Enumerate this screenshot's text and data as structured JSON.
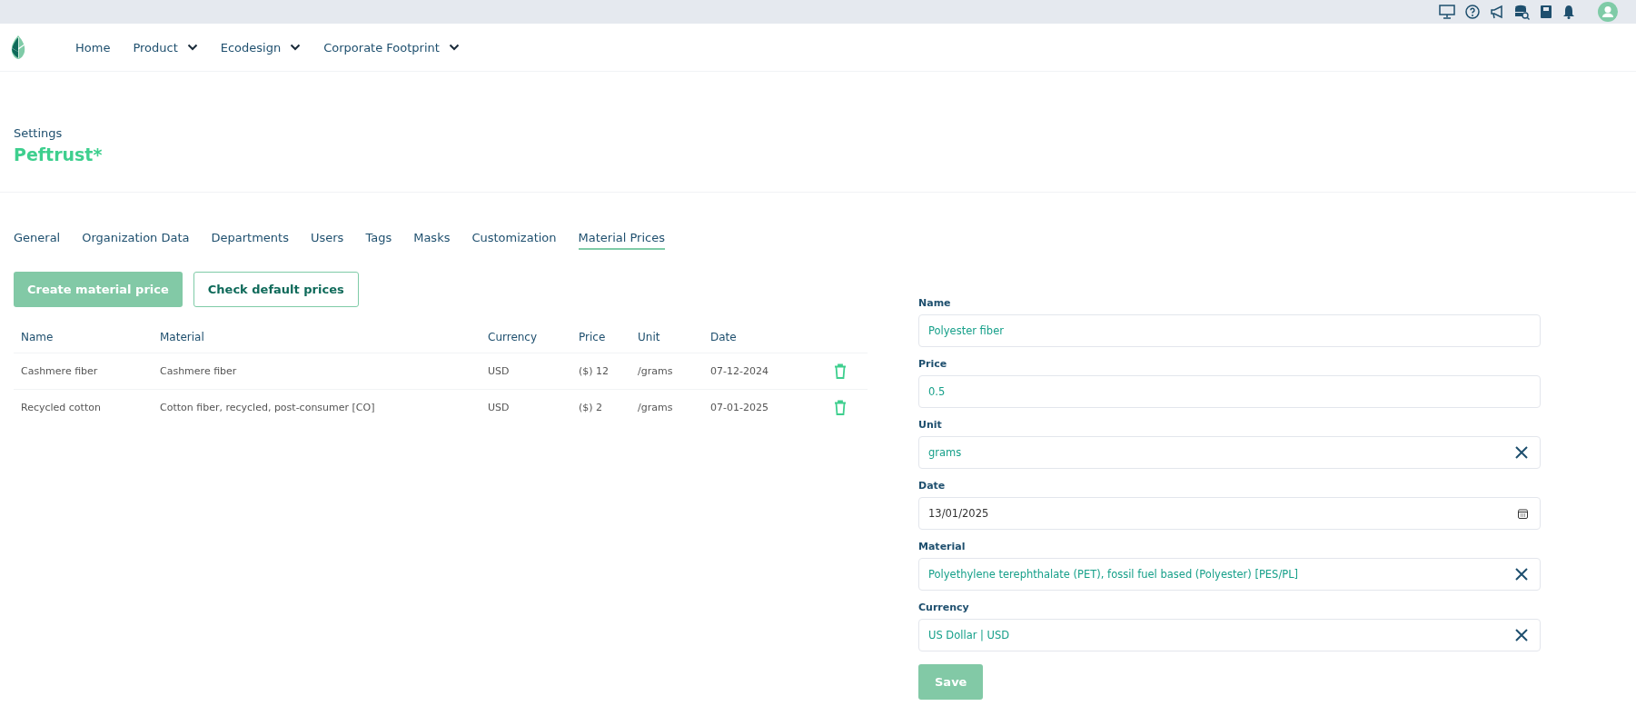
{
  "nav": {
    "items": [
      {
        "label": "Home",
        "dropdown": false
      },
      {
        "label": "Product",
        "dropdown": true
      },
      {
        "label": "Ecodesign",
        "dropdown": true
      },
      {
        "label": "Corporate Footprint",
        "dropdown": true
      }
    ]
  },
  "header": {
    "subtitle": "Settings",
    "title": "Peftrust*"
  },
  "tabs": [
    {
      "label": "General",
      "selected": false
    },
    {
      "label": "Organization Data",
      "selected": false
    },
    {
      "label": "Departments",
      "selected": false
    },
    {
      "label": "Users",
      "selected": false
    },
    {
      "label": "Tags",
      "selected": false
    },
    {
      "label": "Masks",
      "selected": false
    },
    {
      "label": "Customization",
      "selected": false
    },
    {
      "label": "Material Prices",
      "selected": true
    }
  ],
  "actions": [
    {
      "label": "Create material price",
      "kind": "primary"
    },
    {
      "label": "Check default prices",
      "kind": "outline"
    }
  ],
  "table": {
    "columns": [
      "Name",
      "Material",
      "Currency",
      "Price",
      "Unit",
      "Date"
    ],
    "rows": [
      [
        "Cashmere fiber",
        "Cashmere fiber",
        "USD",
        "($) 12",
        "/grams",
        "07-12-2024"
      ],
      [
        "Recycled cotton",
        "Cotton fiber, recycled, post-consumer [CO]",
        "USD",
        "($) 2",
        "/grams",
        "07-01-2025"
      ]
    ]
  },
  "form": {
    "fields": [
      {
        "label": "Name",
        "value": "Polyester fiber",
        "kind": "text"
      },
      {
        "label": "Price",
        "value": "0.5",
        "kind": "text"
      },
      {
        "label": "Unit",
        "value": "grams",
        "kind": "select"
      },
      {
        "label": "Date",
        "value": "13/01/2025",
        "kind": "date"
      },
      {
        "label": "Material",
        "value": "Polyethylene terephthalate (PET), fossil fuel based (Polyester) [PES/PL]",
        "kind": "select"
      },
      {
        "label": "Currency",
        "value": "US Dollar | USD",
        "kind": "select"
      }
    ],
    "submit": "Save"
  }
}
